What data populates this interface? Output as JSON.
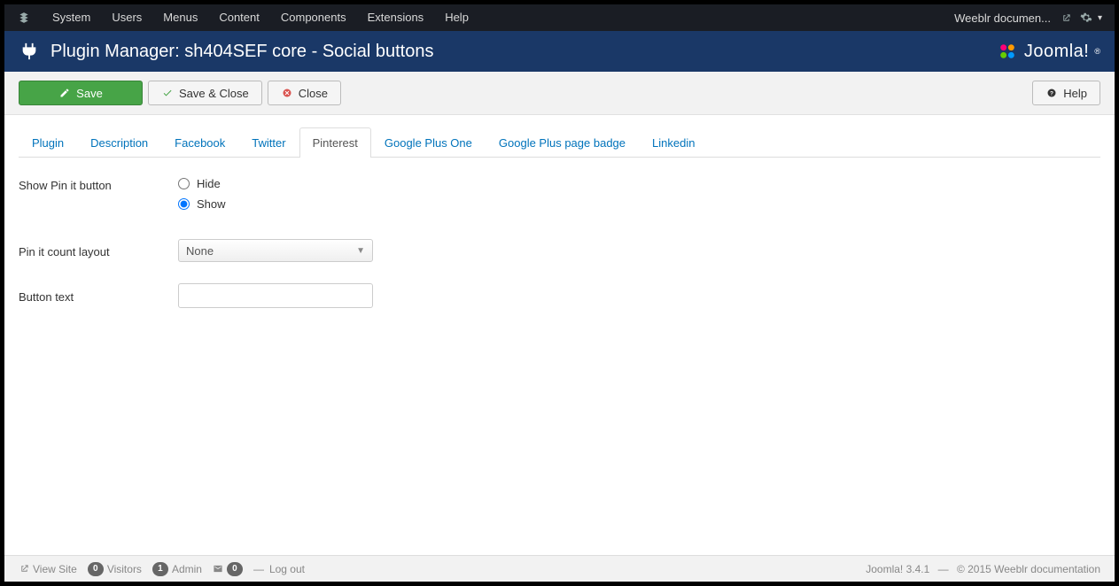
{
  "topmenu": {
    "items": [
      "System",
      "Users",
      "Menus",
      "Content",
      "Components",
      "Extensions",
      "Help"
    ],
    "site_label": "Weeblr documen..."
  },
  "header": {
    "title": "Plugin Manager: sh404SEF core - Social buttons",
    "brand": "Joomla!"
  },
  "toolbar": {
    "save": "Save",
    "save_close": "Save & Close",
    "close": "Close",
    "help": "Help"
  },
  "tabs": [
    "Plugin",
    "Description",
    "Facebook",
    "Twitter",
    "Pinterest",
    "Google Plus One",
    "Google Plus page badge",
    "Linkedin"
  ],
  "active_tab_index": 4,
  "form": {
    "show_pin_label": "Show Pin it button",
    "hide_label": "Hide",
    "show_label": "Show",
    "selected_radio": "show",
    "count_layout_label": "Pin it count layout",
    "count_layout_value": "None",
    "button_text_label": "Button text",
    "button_text_value": ""
  },
  "statusbar": {
    "view_site": "View Site",
    "visitors_count": "0",
    "visitors_label": "Visitors",
    "admin_count": "1",
    "admin_label": "Admin",
    "mail_count": "0",
    "logout": "Log out",
    "version": "Joomla! 3.4.1",
    "copyright": "© 2015 Weeblr documentation"
  }
}
